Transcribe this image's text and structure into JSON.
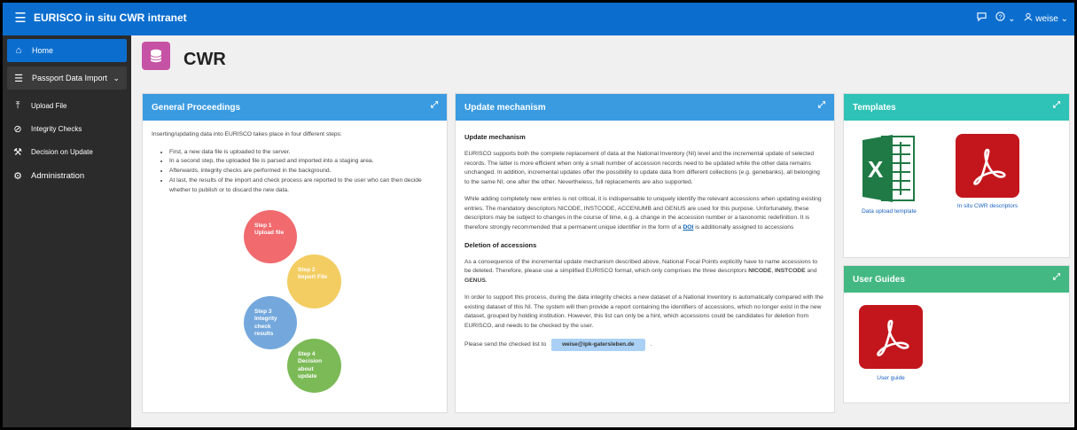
{
  "app": {
    "title": "EURISCO in situ CWR intranet",
    "user": "weise",
    "accent_color": "#0b6ecf"
  },
  "icons": {
    "menu": "hamburger-icon",
    "chat": "chat-icon",
    "help": "help-icon",
    "user": "user-icon",
    "home": "home-icon",
    "passport": "list-icon",
    "upload": "upload-icon",
    "integrity": "check-circle-icon",
    "decision": "wrench-icon",
    "admin": "admin-icon",
    "database": "database-icon",
    "expand": "expand-icon",
    "excel": "excel-icon",
    "pdf": "pdf-icon"
  },
  "sidebar": {
    "items": [
      {
        "label": "Home",
        "active": true
      },
      {
        "label": "Passport Data Import",
        "expandable": true
      },
      {
        "label": "Upload File"
      },
      {
        "label": "Integrity Checks"
      },
      {
        "label": "Decision on Update"
      },
      {
        "label": "Administration"
      }
    ]
  },
  "page": {
    "title": "CWR",
    "tile_color": "#c652a5"
  },
  "general": {
    "title": "General Proceedings",
    "intro": "Inserting/updating data into EURISCO takes place in four different steps:",
    "bullets": [
      "First, a new data file is uploaded to the server.",
      "In a second step, the uploaded file is parsed and imported into a staging area.",
      "Afterwards, integrity checks are performed in the background.",
      "At last, the results of the import and check process are reported to the user who can then decide whether to publish or to discard the new data."
    ],
    "steps": [
      {
        "label": "Step 1 Upload file",
        "color": "#f06a6e"
      },
      {
        "label": "Step 2 Import File",
        "color": "#f3cd62"
      },
      {
        "label": "Step 3 Integrity check results",
        "color": "#74a8dd"
      },
      {
        "label": "Step 4 Decision about update",
        "color": "#7bba56"
      }
    ]
  },
  "update": {
    "title": "Update mechanism",
    "h1": "Update mechanism",
    "p1": "EURISCO supports both the complete replacement of data at the National Inventory (NI) level and the incremental update of selected records. The latter is more efficient when only a small number of accession records need to be updated while the other data remains unchanged. In addition, incremental updates offer the possibility to update data from different collections (e.g. genebanks), all belonging to the same NI, one after the other. Nevertheless, full replacements are also supported.",
    "p2_before": "While adding completely new entries is not critical, it is indispensable to uniquely identify the relevant accessions when updating existing entries. The mandatory descriptors NICODE, INSTCODE, ACCENUMB and GENUS are used for this purpose. Unfortunately, these descriptors may be subject to changes in the course of time, e.g. a change in the accession number or a taxonomic redefinition. It is therefore strongly recommended that a permanent unique identifier in the form of a",
    "doi": "DOI",
    "p2_after": "is additionally assigned to accessions",
    "h2": "Deletion of accessions",
    "p3_before": "As a consequence of the incremental update mechanism described above, National Focal Points explicitly have to name accessions to be deleted. Therefore, please use a simplified EURISCO format, which only comprises the three descriptors",
    "d1": "NICODE",
    "d2": "INSTCODE",
    "and": "and",
    "d3": "GENUS",
    "p4": "In order to support this process, during the data integrity checks a new dataset of a National Inventory is automatically compared with the existing dataset of this NI. The system will then provide a report containing the identifiers of accessions, which no longer exist in the new dataset, grouped by holding institution. However, this list can only be a hint, which accessions could be candidates for deletion from EURISCO, and needs to be checked by the user.",
    "p5": "Please send the checked list to",
    "email": "weise@ipk-gatersleben.de",
    "p5_end": "."
  },
  "templates": {
    "title": "Templates",
    "items": [
      {
        "label": "Data upload template",
        "icon": "excel-icon",
        "color": "#1f7a45"
      },
      {
        "label": "In situ CWR descriptors",
        "icon": "pdf-icon",
        "color": "#c3161c"
      }
    ]
  },
  "guides": {
    "title": "User Guides",
    "items": [
      {
        "label": "User guide",
        "icon": "pdf-icon",
        "color": "#c3161c"
      }
    ]
  }
}
